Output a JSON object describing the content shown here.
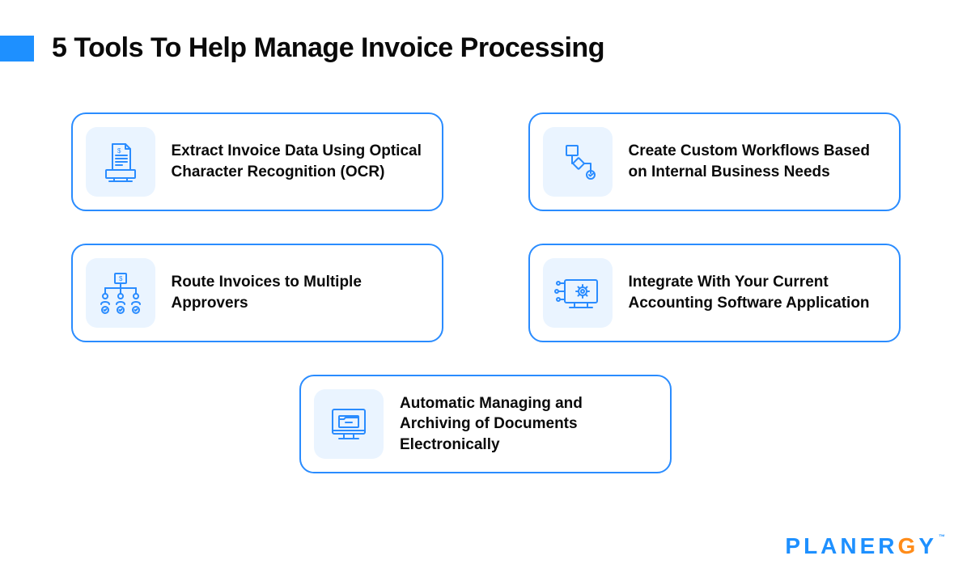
{
  "title": "5 Tools To Help Manage Invoice Processing",
  "accent_color": "#1e90ff",
  "cards": {
    "ocr": {
      "label": "Extract Invoice Data Using Optical Character Recognition (OCR)"
    },
    "workflow": {
      "label": "Create Custom Workflows Based on Internal Business Needs"
    },
    "route": {
      "label": "Route Invoices to Multiple Approvers"
    },
    "integrate": {
      "label": "Integrate With Your Current Accounting Software Application"
    },
    "archive": {
      "label": "Automatic Managing and Archiving of Documents Electronically"
    }
  },
  "logo": {
    "text": "PLANERGY",
    "highlight_index": 6
  }
}
